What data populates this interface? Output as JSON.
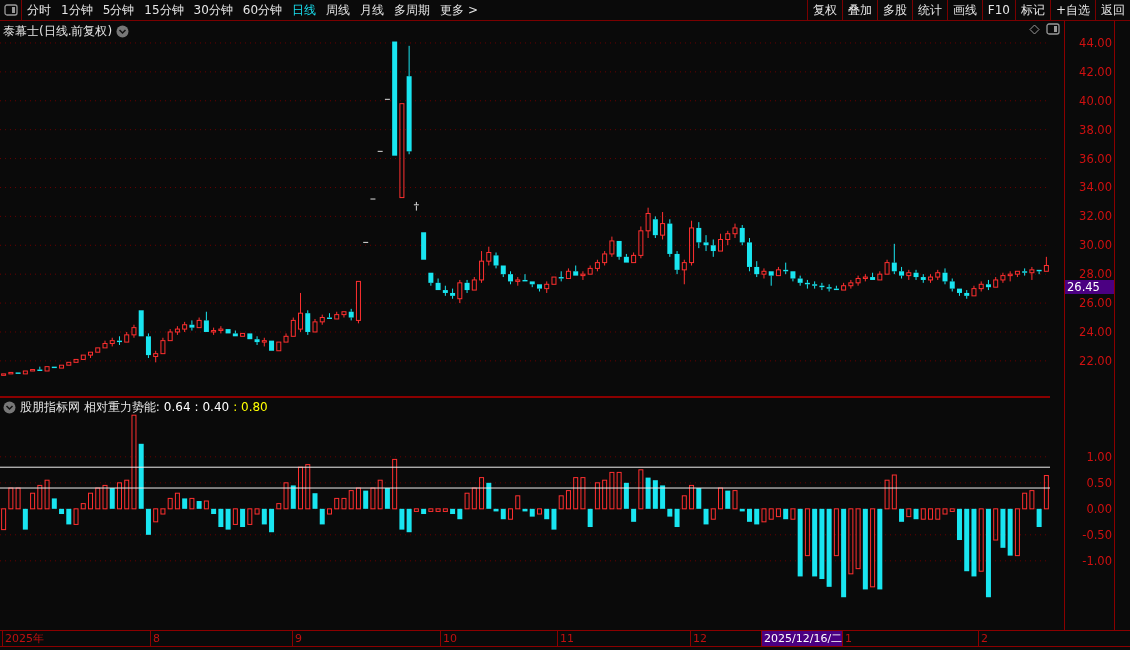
{
  "toolbar": {
    "periods": [
      {
        "label": "分时",
        "selected": false
      },
      {
        "label": "1分钟",
        "selected": false
      },
      {
        "label": "5分钟",
        "selected": false
      },
      {
        "label": "15分钟",
        "selected": false
      },
      {
        "label": "30分钟",
        "selected": false
      },
      {
        "label": "60分钟",
        "selected": false
      },
      {
        "label": "日线",
        "selected": true
      },
      {
        "label": "周线",
        "selected": false
      },
      {
        "label": "月线",
        "selected": false
      },
      {
        "label": "多周期",
        "selected": false
      },
      {
        "label": "更多 >",
        "selected": false
      }
    ],
    "actions": [
      "复权",
      "叠加",
      "多股",
      "统计",
      "画线",
      "F10",
      "标记",
      "+自选",
      "返回"
    ]
  },
  "main_chart": {
    "title": "泰幕士(日线.前复权)",
    "last_price": "26.45",
    "chart_data": {
      "type": "candlestick",
      "ylim": [
        19.5,
        45.52
      ],
      "grid": true,
      "yticks": [
        {
          "value": 44,
          "label": "44.00"
        },
        {
          "value": 42,
          "label": "42.00"
        },
        {
          "value": 40,
          "label": "40.00"
        },
        {
          "value": 38,
          "label": "38.00"
        },
        {
          "value": 36,
          "label": "36.00"
        },
        {
          "value": 34,
          "label": "34.00"
        },
        {
          "value": 32,
          "label": "32.00"
        },
        {
          "value": 30,
          "label": "30.00"
        },
        {
          "value": 28,
          "label": "28.00"
        },
        {
          "value": 26,
          "label": "26.00"
        },
        {
          "value": 24,
          "label": "24.00"
        },
        {
          "value": 22,
          "label": "22.00"
        }
      ],
      "ohlc": [
        [
          21.0,
          21.2,
          20.9,
          21.1
        ],
        [
          21.1,
          21.3,
          21.0,
          21.2
        ],
        [
          21.2,
          21.3,
          21.0,
          21.1
        ],
        [
          21.1,
          21.4,
          21.0,
          21.3
        ],
        [
          21.3,
          21.5,
          21.2,
          21.4
        ],
        [
          21.4,
          21.6,
          21.2,
          21.3
        ],
        [
          21.3,
          21.7,
          21.3,
          21.6
        ],
        [
          21.6,
          21.7,
          21.4,
          21.5
        ],
        [
          21.5,
          21.8,
          21.4,
          21.7
        ],
        [
          21.7,
          22.0,
          21.6,
          21.9
        ],
        [
          21.9,
          22.2,
          21.8,
          22.1
        ],
        [
          22.1,
          22.5,
          22.0,
          22.4
        ],
        [
          22.4,
          22.7,
          22.2,
          22.6
        ],
        [
          22.6,
          23.0,
          22.5,
          22.9
        ],
        [
          22.9,
          23.4,
          22.8,
          23.2
        ],
        [
          23.2,
          23.6,
          23.0,
          23.4
        ],
        [
          23.4,
          23.7,
          23.1,
          23.3
        ],
        [
          23.3,
          24.0,
          23.2,
          23.8
        ],
        [
          23.8,
          24.5,
          23.6,
          24.3
        ],
        [
          25.5,
          25.6,
          23.6,
          23.7
        ],
        [
          23.7,
          23.9,
          22.2,
          22.4
        ],
        [
          22.3,
          22.7,
          21.9,
          22.5
        ],
        [
          22.5,
          23.6,
          22.4,
          23.4
        ],
        [
          23.4,
          24.2,
          23.3,
          24.0
        ],
        [
          24.0,
          24.4,
          23.8,
          24.2
        ],
        [
          24.2,
          24.7,
          24.0,
          24.5
        ],
        [
          24.5,
          24.8,
          24.1,
          24.3
        ],
        [
          24.3,
          25.0,
          24.2,
          24.8
        ],
        [
          24.8,
          25.4,
          23.9,
          24.0
        ],
        [
          24.0,
          24.3,
          23.8,
          24.1
        ],
        [
          24.1,
          24.4,
          23.9,
          24.2
        ],
        [
          24.2,
          24.3,
          23.8,
          23.9
        ],
        [
          23.9,
          24.1,
          23.6,
          23.7
        ],
        [
          23.7,
          24.0,
          23.6,
          23.9
        ],
        [
          23.9,
          24.0,
          23.4,
          23.5
        ],
        [
          23.5,
          23.7,
          23.1,
          23.3
        ],
        [
          23.3,
          23.6,
          23.0,
          23.4
        ],
        [
          23.4,
          23.5,
          22.6,
          22.7
        ],
        [
          22.7,
          23.4,
          22.6,
          23.3
        ],
        [
          23.3,
          23.9,
          23.2,
          23.7
        ],
        [
          23.7,
          25.0,
          23.6,
          24.8
        ],
        [
          24.2,
          26.7,
          24.0,
          25.3
        ],
        [
          25.3,
          25.5,
          23.8,
          24.0
        ],
        [
          24.0,
          24.9,
          23.9,
          24.7
        ],
        [
          24.7,
          25.2,
          24.5,
          25.0
        ],
        [
          25.0,
          25.3,
          24.8,
          24.9
        ],
        [
          24.9,
          25.4,
          24.8,
          25.2
        ],
        [
          25.2,
          25.5,
          25.0,
          25.4
        ],
        [
          25.4,
          25.6,
          24.8,
          25.0
        ],
        [
          24.8,
          27.5,
          24.6,
          27.5
        ],
        [
          30.2,
          30.2,
          30.2,
          30.2
        ],
        [
          33.2,
          33.2,
          33.2,
          33.2
        ],
        [
          36.5,
          36.5,
          36.5,
          36.5
        ],
        [
          40.1,
          40.1,
          40.1,
          40.1
        ],
        [
          44.1,
          44.1,
          36.2,
          36.2
        ],
        [
          33.3,
          39.8,
          33.2,
          39.8
        ],
        [
          41.7,
          43.8,
          36.3,
          36.5
        ],
        [
          32.8,
          33.0,
          32.4,
          32.8
        ],
        [
          30.9,
          31.0,
          29.0,
          29.0
        ],
        [
          28.1,
          28.2,
          27.2,
          27.4
        ],
        [
          27.4,
          27.7,
          26.8,
          26.9
        ],
        [
          26.9,
          27.2,
          26.5,
          26.7
        ],
        [
          26.7,
          27.0,
          26.3,
          26.5
        ],
        [
          26.3,
          27.6,
          26.0,
          27.4
        ],
        [
          27.4,
          27.6,
          26.7,
          26.9
        ],
        [
          26.9,
          27.8,
          26.8,
          27.6
        ],
        [
          27.6,
          29.6,
          27.4,
          28.9
        ],
        [
          28.9,
          29.9,
          28.6,
          29.5
        ],
        [
          29.3,
          29.5,
          28.4,
          28.6
        ],
        [
          28.6,
          28.7,
          27.8,
          28.0
        ],
        [
          28.0,
          28.2,
          27.3,
          27.5
        ],
        [
          27.5,
          27.8,
          27.2,
          27.6
        ],
        [
          27.6,
          28.0,
          27.4,
          27.5
        ],
        [
          27.5,
          27.6,
          27.1,
          27.3
        ],
        [
          27.3,
          27.4,
          26.8,
          27.0
        ],
        [
          27.0,
          27.5,
          26.7,
          27.3
        ],
        [
          27.3,
          27.9,
          27.2,
          27.8
        ],
        [
          27.8,
          28.2,
          27.5,
          27.7
        ],
        [
          27.7,
          28.4,
          27.6,
          28.2
        ],
        [
          28.2,
          28.6,
          27.8,
          27.9
        ],
        [
          27.9,
          28.2,
          27.6,
          28.0
        ],
        [
          28.0,
          28.6,
          27.9,
          28.4
        ],
        [
          28.4,
          29.0,
          28.2,
          28.8
        ],
        [
          28.8,
          29.6,
          28.6,
          29.4
        ],
        [
          29.4,
          30.6,
          29.2,
          30.3
        ],
        [
          30.3,
          30.4,
          29.0,
          29.2
        ],
        [
          29.2,
          29.4,
          28.7,
          28.8
        ],
        [
          28.8,
          29.5,
          28.7,
          29.3
        ],
        [
          29.3,
          31.3,
          29.1,
          31.0
        ],
        [
          31.0,
          32.6,
          30.5,
          32.2
        ],
        [
          31.8,
          32.0,
          30.5,
          30.7
        ],
        [
          30.7,
          32.3,
          30.4,
          31.5
        ],
        [
          31.5,
          31.8,
          29.2,
          29.4
        ],
        [
          29.4,
          29.6,
          28.0,
          28.3
        ],
        [
          28.3,
          29.0,
          27.3,
          28.8
        ],
        [
          28.8,
          31.7,
          28.6,
          31.2
        ],
        [
          31.2,
          31.6,
          29.8,
          30.2
        ],
        [
          30.2,
          30.7,
          29.6,
          30.0
        ],
        [
          30.0,
          30.4,
          29.2,
          29.6
        ],
        [
          29.6,
          30.8,
          29.5,
          30.4
        ],
        [
          30.4,
          31.0,
          30.0,
          30.8
        ],
        [
          30.8,
          31.5,
          30.5,
          31.2
        ],
        [
          31.2,
          31.4,
          30.0,
          30.2
        ],
        [
          30.2,
          30.5,
          28.2,
          28.5
        ],
        [
          28.5,
          28.9,
          27.8,
          28.0
        ],
        [
          28.0,
          28.4,
          27.7,
          28.2
        ],
        [
          28.2,
          28.3,
          27.2,
          27.9
        ],
        [
          27.9,
          28.5,
          27.8,
          28.3
        ],
        [
          28.3,
          28.8,
          28.0,
          28.2
        ],
        [
          28.2,
          28.3,
          27.5,
          27.7
        ],
        [
          27.7,
          27.9,
          27.2,
          27.4
        ],
        [
          27.4,
          27.6,
          27.0,
          27.3
        ],
        [
          27.3,
          27.5,
          27.0,
          27.2
        ],
        [
          27.2,
          27.4,
          26.9,
          27.1
        ],
        [
          27.1,
          27.3,
          26.8,
          27.0
        ],
        [
          27.0,
          27.2,
          26.8,
          26.9
        ],
        [
          26.9,
          27.4,
          26.8,
          27.2
        ],
        [
          27.2,
          27.6,
          27.0,
          27.4
        ],
        [
          27.4,
          27.9,
          27.2,
          27.7
        ],
        [
          27.7,
          28.0,
          27.5,
          27.8
        ],
        [
          27.8,
          28.1,
          27.5,
          27.6
        ],
        [
          27.6,
          28.2,
          27.5,
          28.0
        ],
        [
          28.0,
          29.0,
          27.9,
          28.8
        ],
        [
          28.8,
          30.1,
          28.0,
          28.2
        ],
        [
          28.2,
          28.5,
          27.7,
          27.9
        ],
        [
          27.9,
          28.3,
          27.6,
          28.1
        ],
        [
          28.1,
          28.3,
          27.6,
          27.8
        ],
        [
          27.8,
          28.0,
          27.4,
          27.6
        ],
        [
          27.6,
          28.0,
          27.4,
          27.8
        ],
        [
          27.8,
          28.3,
          27.6,
          28.1
        ],
        [
          28.1,
          28.4,
          27.3,
          27.5
        ],
        [
          27.5,
          27.7,
          26.8,
          27.0
        ],
        [
          27.0,
          27.1,
          26.5,
          26.7
        ],
        [
          26.7,
          26.9,
          26.3,
          26.5
        ],
        [
          26.5,
          27.2,
          26.4,
          27.0
        ],
        [
          27.0,
          27.5,
          26.8,
          27.3
        ],
        [
          27.3,
          27.6,
          26.9,
          27.1
        ],
        [
          27.1,
          27.8,
          27.0,
          27.6
        ],
        [
          27.6,
          28.1,
          27.4,
          27.9
        ],
        [
          27.9,
          28.2,
          27.5,
          28.0
        ],
        [
          28.0,
          28.3,
          27.8,
          28.2
        ],
        [
          28.2,
          28.4,
          27.9,
          28.1
        ],
        [
          28.1,
          28.5,
          27.6,
          28.3
        ],
        [
          28.3,
          28.4,
          28.0,
          28.2
        ],
        [
          28.2,
          29.2,
          28.1,
          28.6
        ]
      ]
    }
  },
  "indicator": {
    "name": "股朋指标网 相对重力势能:",
    "values": [
      {
        "text": "0.64",
        "color": "#ffffff"
      },
      {
        "text": ": 0.40",
        "color": "#ffffff"
      },
      {
        "text": ": 0.80",
        "color": "#ffff00"
      }
    ],
    "chart_data": {
      "type": "bar",
      "ylim": [
        -2.33,
        2.15
      ],
      "yticks": [
        {
          "value": 1,
          "label": "1.00"
        },
        {
          "value": 0.5,
          "label": "0.50"
        },
        {
          "value": 0,
          "label": "0.00"
        },
        {
          "value": -0.5,
          "label": "-0.50"
        },
        {
          "value": -1,
          "label": "-1.00"
        }
      ],
      "grid": true,
      "values": [
        -0.4,
        0.4,
        0.4,
        -0.4,
        0.3,
        0.45,
        0.55,
        0.2,
        -0.1,
        -0.3,
        -0.3,
        0.1,
        0.3,
        0.4,
        0.45,
        0.4,
        0.5,
        0.55,
        1.8,
        1.25,
        -0.5,
        -0.25,
        -0.1,
        0.2,
        0.3,
        0.2,
        0.2,
        0.15,
        0.15,
        -0.1,
        -0.35,
        -0.4,
        -0.3,
        -0.35,
        -0.3,
        -0.1,
        -0.3,
        -0.45,
        0.1,
        0.5,
        0.45,
        0.8,
        0.85,
        0.3,
        -0.3,
        -0.1,
        0.2,
        0.2,
        0.35,
        0.4,
        0.35,
        0.4,
        0.55,
        0.4,
        0.95,
        -0.4,
        -0.45,
        -0.05,
        -0.1,
        -0.05,
        -0.05,
        -0.05,
        -0.1,
        -0.2,
        0.3,
        0.4,
        0.6,
        0.5,
        -0.05,
        -0.2,
        -0.2,
        0.25,
        -0.05,
        -0.15,
        -0.1,
        -0.2,
        -0.4,
        0.25,
        0.35,
        0.6,
        0.6,
        -0.35,
        0.5,
        0.55,
        0.7,
        0.7,
        0.5,
        -0.25,
        0.75,
        0.6,
        0.55,
        0.45,
        -0.15,
        -0.35,
        0.25,
        0.45,
        0.4,
        -0.3,
        -0.2,
        0.4,
        0.35,
        0.35,
        -0.05,
        -0.25,
        -0.3,
        -0.25,
        -0.2,
        -0.15,
        -0.2,
        -0.2,
        -1.3,
        -0.9,
        -1.3,
        -1.35,
        -1.5,
        -0.9,
        -1.7,
        -1.25,
        -1.15,
        -1.55,
        -1.5,
        -1.55,
        0.55,
        0.65,
        -0.25,
        -0.15,
        -0.2,
        -0.2,
        -0.2,
        -0.2,
        -0.1,
        -0.05,
        -0.6,
        -1.2,
        -1.3,
        -1.2,
        -1.7,
        -0.6,
        -0.75,
        -0.9,
        -0.9,
        0.3,
        0.35,
        -0.35,
        0.64
      ]
    }
  },
  "date_axis": [
    {
      "label": "2025年",
      "kind": "month"
    },
    {
      "label": "8",
      "kind": "month"
    },
    {
      "label": "9",
      "kind": "month"
    },
    {
      "label": "10",
      "kind": "month"
    },
    {
      "label": "11",
      "kind": "month"
    },
    {
      "label": "12",
      "kind": "month"
    },
    {
      "label": "2025/12/16/二",
      "kind": "cursor"
    },
    {
      "label": "1",
      "kind": "month"
    },
    {
      "label": "2",
      "kind": "month"
    }
  ]
}
